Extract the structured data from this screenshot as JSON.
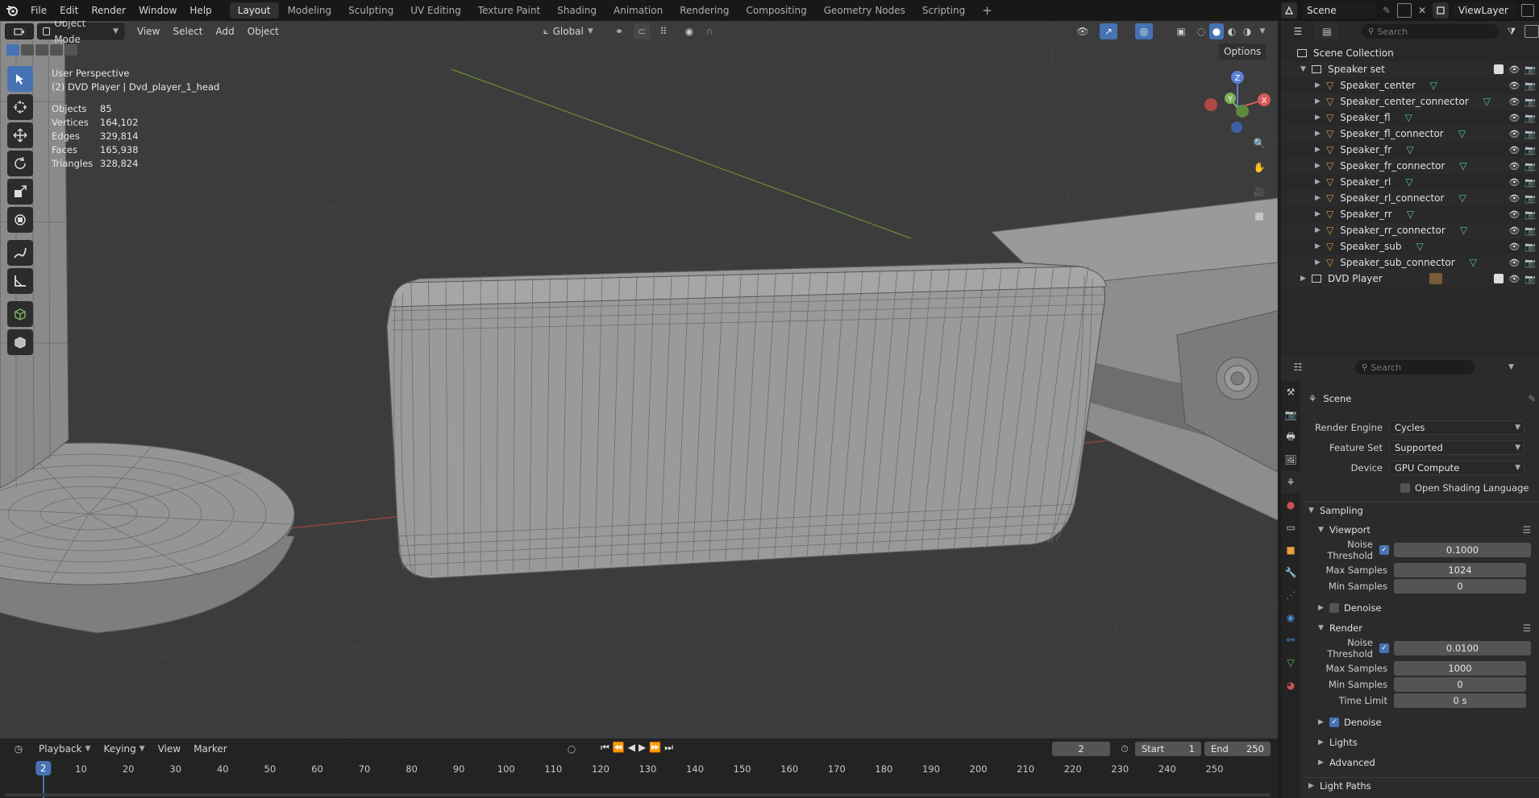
{
  "menubar": {
    "menus": [
      "File",
      "Edit",
      "Render",
      "Window",
      "Help"
    ],
    "workspaces": [
      "Layout",
      "Modeling",
      "Sculpting",
      "UV Editing",
      "Texture Paint",
      "Shading",
      "Animation",
      "Rendering",
      "Compositing",
      "Geometry Nodes",
      "Scripting"
    ],
    "active_workspace": "Layout",
    "add_workspace": "+",
    "scene_name": "Scene",
    "view_layer": "ViewLayer"
  },
  "viewport": {
    "mode": "Object Mode",
    "menus": [
      "View",
      "Select",
      "Add",
      "Object"
    ],
    "transform_orientation": "Global",
    "options_label": "Options",
    "perspective_label": "User Perspective",
    "active_object_label": "(2) DVD Player | Dvd_player_1_head",
    "stats": [
      {
        "key": "Objects",
        "value": "85"
      },
      {
        "key": "Vertices",
        "value": "164,102"
      },
      {
        "key": "Edges",
        "value": "329,814"
      },
      {
        "key": "Faces",
        "value": "165,938"
      },
      {
        "key": "Triangles",
        "value": "328,824"
      }
    ],
    "gizmo_axes": [
      "X",
      "Y",
      "Z"
    ]
  },
  "outliner": {
    "search_placeholder": "Search",
    "root": "Scene Collection",
    "collection": "Speaker set",
    "objects": [
      "Speaker_center",
      "Speaker_center_connector",
      "Speaker_fl",
      "Speaker_fl_connector",
      "Speaker_fr",
      "Speaker_fr_connector",
      "Speaker_rl",
      "Speaker_rl_connector",
      "Speaker_rr",
      "Speaker_rr_connector",
      "Speaker_sub",
      "Speaker_sub_connector"
    ],
    "collection2": "DVD Player"
  },
  "properties": {
    "search_placeholder": "Search",
    "context": "Scene",
    "render_engine_label": "Render Engine",
    "render_engine": "Cycles",
    "feature_set_label": "Feature Set",
    "feature_set": "Supported",
    "device_label": "Device",
    "device": "GPU Compute",
    "osl_label": "Open Shading Language",
    "sampling": "Sampling",
    "viewport_panel": "Viewport",
    "render_panel": "Render",
    "noise_threshold_label": "Noise Threshold",
    "vp_noise_threshold": "0.1000",
    "max_samples_label": "Max Samples",
    "vp_max_samples": "1024",
    "min_samples_label": "Min Samples",
    "vp_min_samples": "0",
    "denoise_label": "Denoise",
    "r_noise_threshold": "0.0100",
    "r_max_samples": "1000",
    "r_min_samples": "0",
    "time_limit_label": "Time Limit",
    "r_time_limit": "0 s",
    "lights": "Lights",
    "advanced": "Advanced",
    "light_paths": "Light Paths"
  },
  "timeline": {
    "menus": [
      "Playback",
      "Keying",
      "View",
      "Marker"
    ],
    "current_frame": "2",
    "start_label": "Start",
    "start": "1",
    "end_label": "End",
    "end": "250",
    "ticks": [
      "10",
      "20",
      "30",
      "40",
      "50",
      "60",
      "70",
      "80",
      "90",
      "100",
      "110",
      "120",
      "130",
      "140",
      "150",
      "160",
      "170",
      "180",
      "190",
      "200",
      "210",
      "220",
      "230",
      "240",
      "250"
    ],
    "playhead": "2"
  }
}
